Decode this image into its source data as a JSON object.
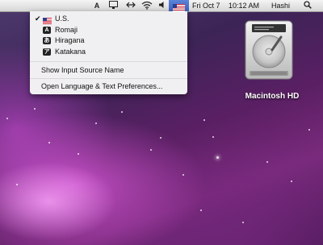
{
  "menubar": {
    "date": "Fri Oct 7",
    "time": "10:12 AM",
    "user": "Hashi",
    "icons": [
      "adobe-icon",
      "display-icon",
      "sync-icon",
      "wifi-icon",
      "volume-icon",
      "input-source-flag-icon",
      "spotlight-icon"
    ]
  },
  "input_menu": {
    "items": [
      {
        "label": "U.S.",
        "checked": true,
        "icon": "us-flag-icon"
      },
      {
        "label": "Romaji",
        "checked": false,
        "icon": "romaji-icon"
      },
      {
        "label": "Hiragana",
        "checked": false,
        "icon": "hiragana-icon"
      },
      {
        "label": "Katakana",
        "checked": false,
        "icon": "katakana-icon"
      }
    ],
    "show_name": "Show Input Source Name",
    "open_prefs": "Open Language & Text Preferences..."
  },
  "desktop": {
    "drive_label": "Macintosh HD"
  }
}
